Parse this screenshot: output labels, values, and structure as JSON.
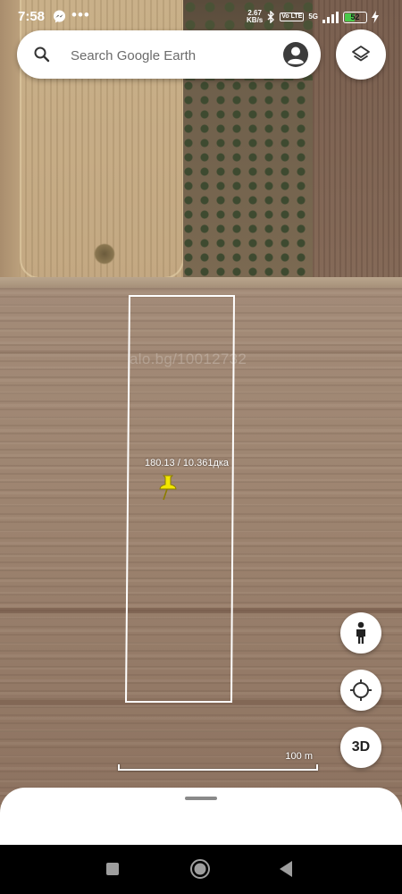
{
  "status_bar": {
    "time": "7:58",
    "more": "•••",
    "net_speed_value": "2.67",
    "net_speed_unit": "KB/s",
    "volte": "Vo LTE",
    "network": "5G",
    "battery": "52"
  },
  "search": {
    "placeholder": "Search Google Earth"
  },
  "map": {
    "watermark": "alo.bg/10012732",
    "parcel_label": "180.13 / 10.361дка",
    "scale_label": "100 m"
  },
  "buttons": {
    "three_d_label": "3D"
  },
  "colors": {
    "battery_fill": "#49c94a",
    "parcel_outline": "#ffffff",
    "pin": "#f2e600"
  },
  "icons": {
    "search": "search-icon",
    "account": "avatar-icon",
    "layers": "layers-icon",
    "street_view": "pegman-icon",
    "my_location": "crosshair-icon",
    "nav_recents": "square-icon",
    "nav_home": "circle-icon",
    "nav_back": "triangle-icon"
  },
  "battery_level": 0.52
}
